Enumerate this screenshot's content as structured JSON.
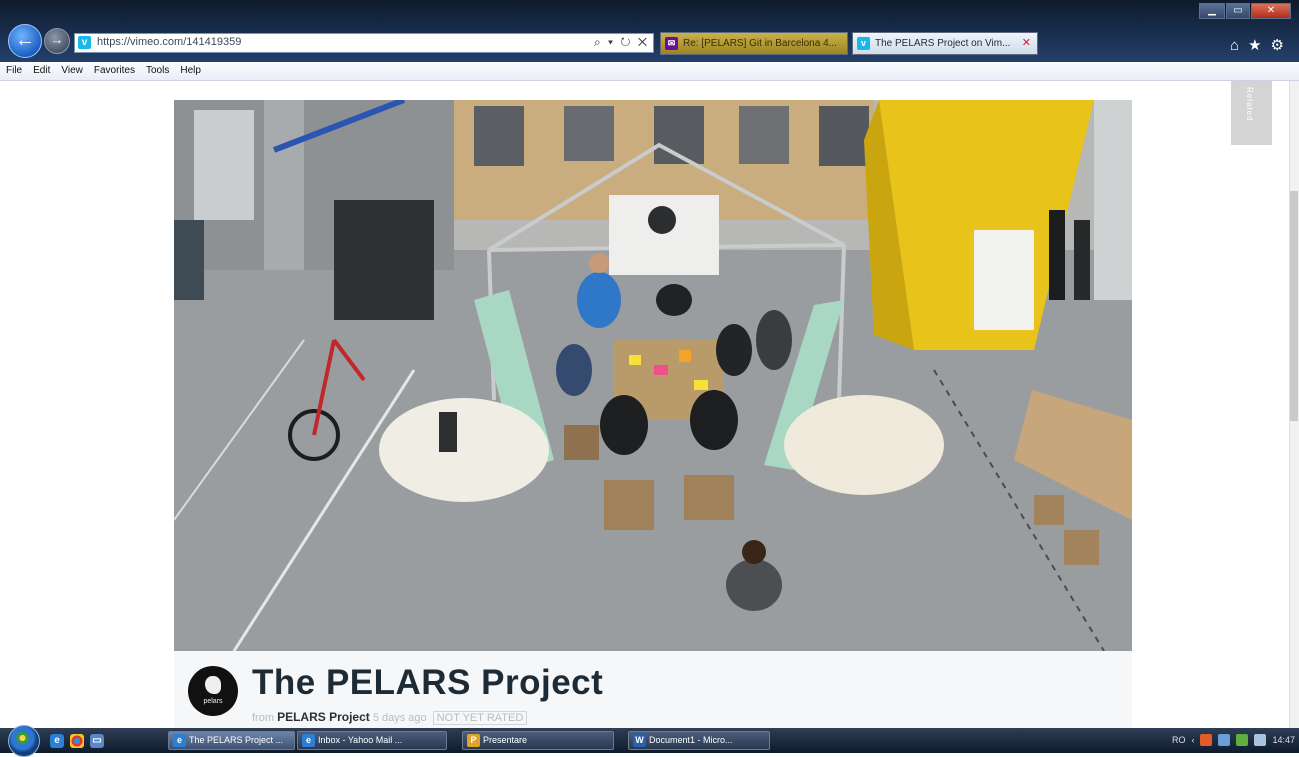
{
  "browser": {
    "url": "https://vimeo.com/141419359",
    "site_icon": "vimeo-icon",
    "address_tools": "⌕ ▾ ↻ ✕",
    "tabs": [
      {
        "label": "Re: [PELARS] Git in Barcelona 4...",
        "icon": "yahoo-mail-icon",
        "active": false
      },
      {
        "label": "The PELARS Project on Vim...",
        "icon": "vimeo-icon",
        "active": true,
        "close": "✕"
      }
    ],
    "toolbar_icons": [
      "home-icon",
      "favorites-star-icon",
      "gear-icon"
    ],
    "window_controls": {
      "minimize": "▁",
      "maximize": "▭",
      "close": "✕"
    }
  },
  "menu": {
    "items": [
      "File",
      "Edit",
      "View",
      "Favorites",
      "Tools",
      "Help"
    ]
  },
  "page": {
    "side_panel_text": "Related",
    "video": {
      "title": "The PELARS Project",
      "owner_prefix": "from",
      "owner": "PELARS Project",
      "age": "5 days ago",
      "rating_badge": "NOT YET RATED",
      "avatar_text": "pelars"
    }
  },
  "taskbar": {
    "quick_launch": [
      "ie-icon",
      "chrome-icon",
      "show-desktop-icon"
    ],
    "buttons": [
      {
        "label": "The PELARS Project ...",
        "icon": "ie-icon",
        "active": true
      },
      {
        "label": "Inbox - Yahoo Mail ...",
        "icon": "ie-icon",
        "active": false
      },
      {
        "label": "Presentare",
        "icon": "powerpoint-icon",
        "active": false
      },
      {
        "label": "Document1 - Micro...",
        "icon": "word-icon",
        "active": false
      }
    ],
    "tray": {
      "language": "RO",
      "time": "14:47"
    }
  },
  "colors": {
    "vimeo_blue": "#1ab7ea",
    "title_text": "#1d2b36",
    "meta_background": "#f6f7f8"
  }
}
